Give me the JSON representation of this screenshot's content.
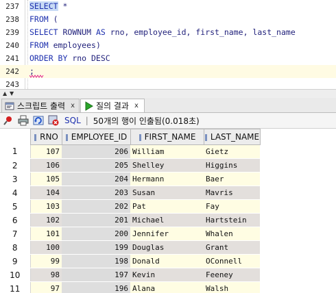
{
  "editor": {
    "lines": [
      {
        "num": "237",
        "kw1": "SELECT",
        "rest": " *"
      },
      {
        "num": "238",
        "kw1": "FROM",
        "rest": " ("
      },
      {
        "num": "239",
        "kw1": "SELECT",
        "mid": " ROWNUM ",
        "kw2": "AS",
        "rest": " rno, employee_id, first_name, last_name"
      },
      {
        "num": "240",
        "kw1": "FROM",
        "rest": " employees)"
      },
      {
        "num": "241",
        "kw1": "ORDER BY",
        "rest": " rno DESC"
      },
      {
        "num": "242",
        "rest": ";"
      },
      {
        "num": "243",
        "rest": ""
      }
    ]
  },
  "tabs": {
    "script_output": "스크립트 출력",
    "query_result": "질의 결과",
    "close": "x"
  },
  "toolbar": {
    "sql_label": "SQL",
    "separator": "|",
    "status": "50개의 행이 인출됨(0.018초)"
  },
  "grid": {
    "columns": [
      "RNO",
      "EMPLOYEE_ID",
      "FIRST_NAME",
      "LAST_NAME"
    ],
    "rows": [
      {
        "n": "1",
        "rno": "107",
        "id": "206",
        "first": "William",
        "last": "Gietz"
      },
      {
        "n": "2",
        "rno": "106",
        "id": "205",
        "first": "Shelley",
        "last": "Higgins"
      },
      {
        "n": "3",
        "rno": "105",
        "id": "204",
        "first": "Hermann",
        "last": "Baer"
      },
      {
        "n": "4",
        "rno": "104",
        "id": "203",
        "first": "Susan",
        "last": "Mavris"
      },
      {
        "n": "5",
        "rno": "103",
        "id": "202",
        "first": "Pat",
        "last": "Fay"
      },
      {
        "n": "6",
        "rno": "102",
        "id": "201",
        "first": "Michael",
        "last": "Hartstein"
      },
      {
        "n": "7",
        "rno": "101",
        "id": "200",
        "first": "Jennifer",
        "last": "Whalen"
      },
      {
        "n": "8",
        "rno": "100",
        "id": "199",
        "first": "Douglas",
        "last": "Grant"
      },
      {
        "n": "9",
        "rno": "99",
        "id": "198",
        "first": "Donald",
        "last": "OConnell"
      },
      {
        "n": "10",
        "rno": "98",
        "id": "197",
        "first": "Kevin",
        "last": "Feeney"
      },
      {
        "n": "11",
        "rno": "97",
        "id": "196",
        "first": "Alana",
        "last": "Walsh"
      }
    ]
  },
  "colors": {
    "keyword": "#1c2fae",
    "current_line": "#fffbe3",
    "row_odd": "#fffde3",
    "row_even": "#e3dfdc"
  }
}
